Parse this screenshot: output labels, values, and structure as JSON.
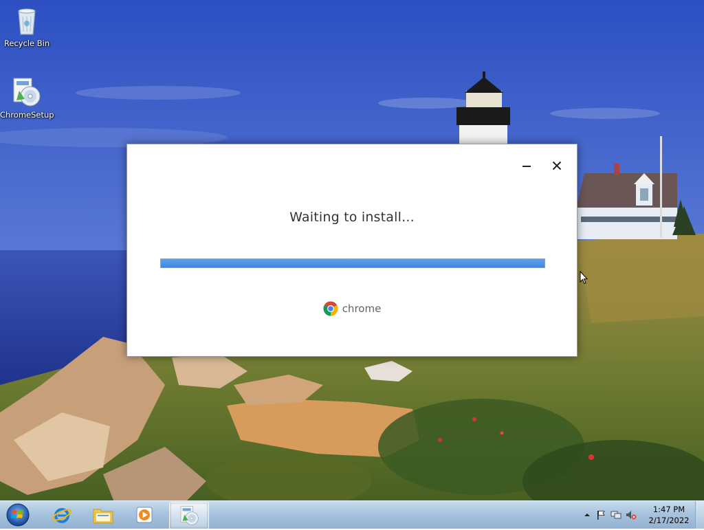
{
  "desktop": {
    "icons": [
      {
        "label": "Recycle Bin",
        "icon": "recycle-bin-icon"
      },
      {
        "label": "ChromeSetup",
        "icon": "installer-icon"
      }
    ]
  },
  "installer": {
    "status": "Waiting to install...",
    "progress_fraction": 1.0,
    "brand_name": "chrome",
    "controls": {
      "minimize": "minimize-icon",
      "close": "close-icon"
    }
  },
  "taskbar": {
    "start": "windows-start-icon",
    "pinned": [
      {
        "name": "internet-explorer",
        "icon": "internet-explorer-icon"
      },
      {
        "name": "file-explorer",
        "icon": "folder-icon"
      },
      {
        "name": "media-player",
        "icon": "media-player-icon"
      },
      {
        "name": "chrome-setup",
        "icon": "installer-icon",
        "active": true
      }
    ],
    "tray": {
      "icons": [
        "show-hidden-icons-chevron",
        "action-center-flag-icon",
        "network-icon",
        "volume-muted-icon"
      ],
      "time": "1:47 PM",
      "date": "2/17/2022"
    }
  },
  "colors": {
    "progress": "#4a92e6",
    "taskbar": "#a7c3de",
    "sky": "#4a6fd0"
  }
}
